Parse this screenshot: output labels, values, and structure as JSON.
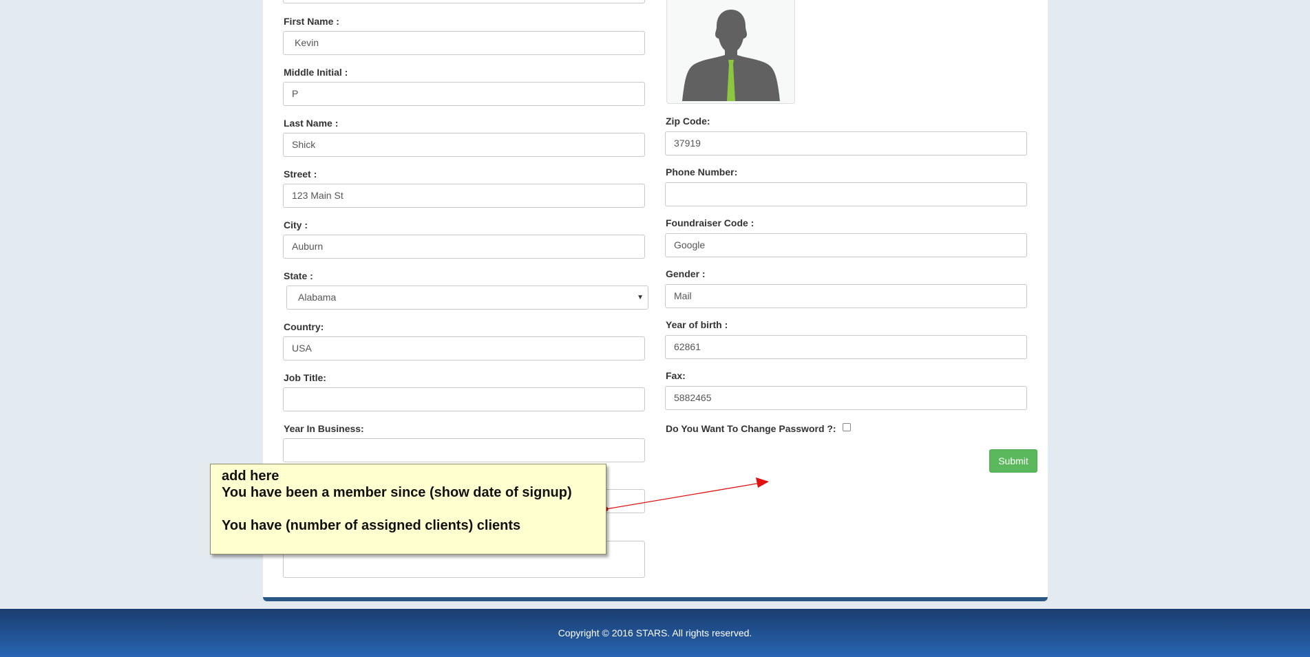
{
  "form": {
    "first_name": {
      "label": "First Name :",
      "value": "Kevin"
    },
    "middle_initial": {
      "label": "Middle Initial :",
      "value": "P"
    },
    "last_name": {
      "label": "Last Name :",
      "value": "Shick"
    },
    "street": {
      "label": "Street :",
      "value": "123 Main St"
    },
    "city": {
      "label": "City :",
      "value": "Auburn"
    },
    "state": {
      "label": "State :",
      "value": "Alabama"
    },
    "country": {
      "label": "Country:",
      "value": "USA"
    },
    "job_title": {
      "label": "Job Title:",
      "value": ""
    },
    "year_in_business": {
      "label": "Year In Business:",
      "value": ""
    },
    "zip_code": {
      "label": "Zip Code:",
      "value": "37919"
    },
    "phone_number": {
      "label": "Phone Number:",
      "value": ""
    },
    "fundraiser_code": {
      "label": "Foundraiser Code :",
      "value": "Google"
    },
    "gender": {
      "label": "Gender :",
      "value": "Mail"
    },
    "year_of_birth": {
      "label": "Year of birth :",
      "value": "62861"
    },
    "fax": {
      "label": "Fax:",
      "value": "5882465"
    },
    "change_password": {
      "label": "Do You Want To Change Password ?:",
      "checked": false
    },
    "submit_label": "Submit"
  },
  "annotation": {
    "line1": "add here",
    "line2": "You have been a member since (show date of signup)",
    "line3": "You have (number of assigned clients) clients"
  },
  "footer": {
    "text": "Copyright © 2016 STARS. All rights reserved."
  },
  "colors": {
    "submit": "#5cb85c",
    "footer": "#1f4f8f",
    "note_background": "#ffffd0",
    "arrow": "#e01010",
    "avatar_tie": "#8dc63f"
  },
  "icons": {
    "profile_photo": "person-silhouette-icon",
    "state_dropdown": "caret-down-icon"
  }
}
